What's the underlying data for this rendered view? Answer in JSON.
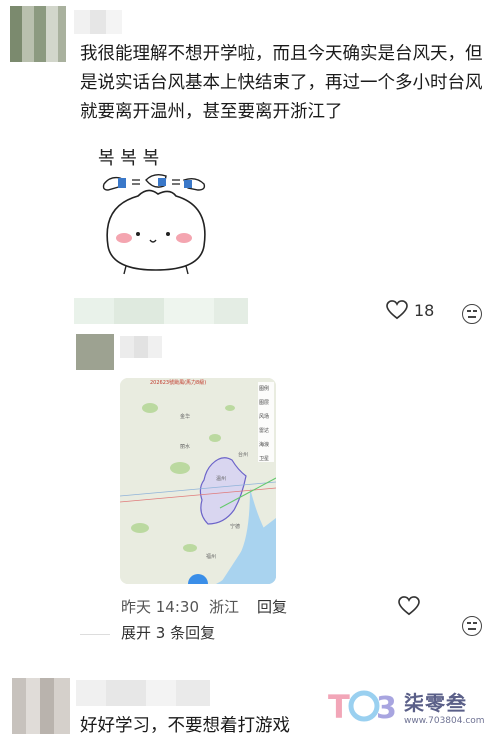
{
  "comment1": {
    "text": "我很能理解不想开学啦，而且今天确实是台风天，但是说实话台风基本上快结束了，再过一个多小时台风就要离开温州，甚至要离开浙江了",
    "sticker_text": "복 복 복",
    "like_count": "18"
  },
  "reply1": {
    "time": "昨天 14:30",
    "location": "浙江",
    "reply_label": "回复",
    "expand_label": "展开 3 条回复",
    "map_header": "202623號颱風(馬力8級)",
    "map_labels": [
      "金华",
      "温州",
      "福州",
      "台州",
      "宁德",
      "丽水"
    ],
    "map_tools": [
      "图例",
      "图层",
      "风场",
      "雷达",
      "海浪",
      "卫星"
    ]
  },
  "comment2": {
    "text": "好好学习，不要想着打游戏"
  },
  "watermark": {
    "logo": "TOB",
    "brand": "柒零叁",
    "url": "www.703804.com"
  }
}
